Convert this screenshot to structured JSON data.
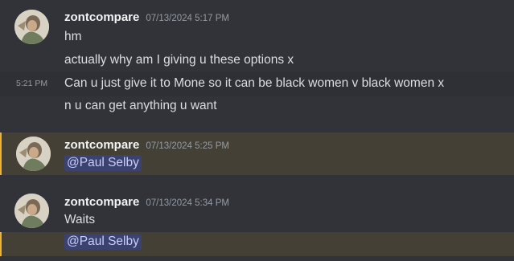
{
  "colors": {
    "background": "#313338",
    "hover_background": "#2e3035",
    "mention_highlight_background": "#444036",
    "mention_highlight_bar": "#f0b232",
    "mention_pill_background": "#3c4270",
    "mention_pill_text": "#c9cdfb"
  },
  "groups": [
    {
      "avatar": "user-avatar",
      "username": "zontcompare",
      "timestamp": "07/13/2024 5:17 PM",
      "lines": [
        {
          "text": "hm"
        },
        {
          "text": "actually why am I giving u these options x"
        },
        {
          "side_time": "5:21 PM",
          "text": "Can u just give it to Mone so it can be black women v black women x"
        },
        {
          "text": "n u can get anything u want"
        }
      ]
    },
    {
      "avatar": "user-avatar",
      "username": "zontcompare",
      "timestamp": "07/13/2024 5:25 PM",
      "lines": [
        {
          "mention": "@Paul Selby"
        }
      ]
    },
    {
      "avatar": "user-avatar",
      "username": "zontcompare",
      "timestamp": "07/13/2024 5:34 PM",
      "lines": [
        {
          "text": "Waits"
        },
        {
          "mention": "@Paul Selby"
        }
      ]
    }
  ]
}
